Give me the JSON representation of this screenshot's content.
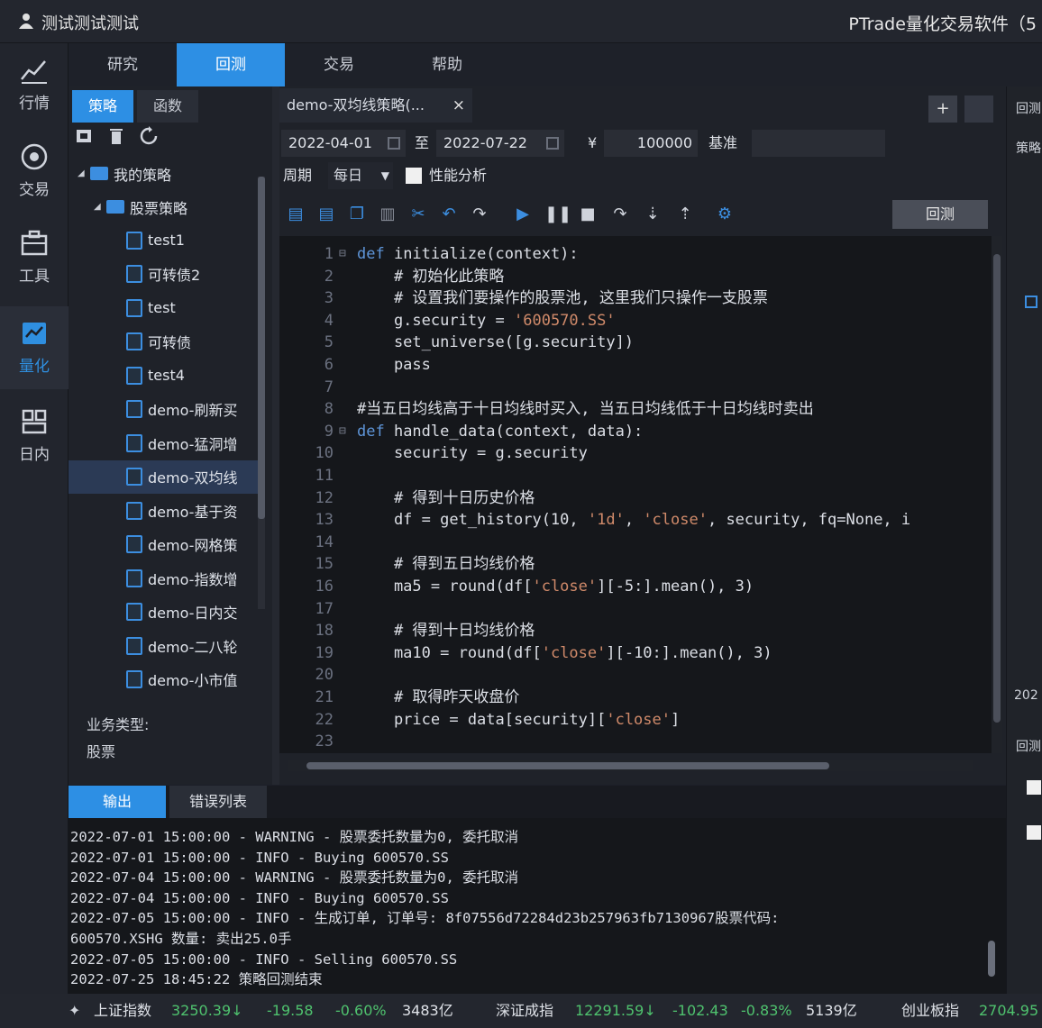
{
  "titlebar": {
    "user": "测试测试测试",
    "app_title": "PTrade量化交易软件（5"
  },
  "nav": [
    {
      "label": "行情",
      "icon": "chart-icon"
    },
    {
      "label": "交易",
      "icon": "trade-icon"
    },
    {
      "label": "工具",
      "icon": "toolbox-icon"
    },
    {
      "label": "量化",
      "icon": "quant-icon"
    },
    {
      "label": "日内",
      "icon": "intraday-icon"
    }
  ],
  "menu": [
    "研究",
    "回测",
    "交易",
    "帮助"
  ],
  "panel": {
    "tabs": [
      "策略",
      "函数"
    ],
    "tree": {
      "root": "我的策略",
      "folder": "股票策略",
      "files": [
        "test1",
        "可转债2",
        "test",
        "可转债",
        "test4",
        "demo-刷新买",
        "demo-猛洞增",
        "demo-双均线",
        "demo-基于资",
        "demo-网格策",
        "demo-指数增",
        "demo-日内交",
        "demo-二八轮",
        "demo-小市值"
      ]
    },
    "biz_label": "业务类型:",
    "biz_value": "股票"
  },
  "editor": {
    "file_tab": "demo-双均线策略(...",
    "close": "×",
    "plus": "+",
    "start_date": "2022-04-01",
    "to": "至",
    "end_date": "2022-07-22",
    "currency": "¥",
    "capital": "100000",
    "benchmark_label": "基准",
    "period_label": "周期",
    "period_value": "每日",
    "perf_label": "性能分析",
    "run_button": "回测"
  },
  "code_lines": [
    [
      "1",
      "def initialize(context):"
    ],
    [
      "2",
      "    # 初始化此策略"
    ],
    [
      "3",
      "    # 设置我们要操作的股票池, 这里我们只操作一支股票"
    ],
    [
      "4",
      "    g.security = '600570.SS'"
    ],
    [
      "5",
      "    set_universe([g.security])"
    ],
    [
      "6",
      "    pass"
    ],
    [
      "7",
      ""
    ],
    [
      "8",
      "#当五日均线高于十日均线时买入, 当五日均线低于十日均线时卖出"
    ],
    [
      "9",
      "def handle_data(context, data):"
    ],
    [
      "10",
      "    security = g.security"
    ],
    [
      "11",
      ""
    ],
    [
      "12",
      "    # 得到十日历史价格"
    ],
    [
      "13",
      "    df = get_history(10, '1d', 'close', security, fq=None, i"
    ],
    [
      "14",
      ""
    ],
    [
      "15",
      "    # 得到五日均线价格"
    ],
    [
      "16",
      "    ma5 = round(df['close'][-5:].mean(), 3)"
    ],
    [
      "17",
      ""
    ],
    [
      "18",
      "    # 得到十日均线价格"
    ],
    [
      "19",
      "    ma10 = round(df['close'][-10:].mean(), 3)"
    ],
    [
      "20",
      ""
    ],
    [
      "21",
      "    # 取得昨天收盘价"
    ],
    [
      "22",
      "    price = data[security]['close']"
    ],
    [
      "23",
      ""
    ]
  ],
  "output": {
    "tabs": [
      "输出",
      "错误列表"
    ],
    "lines": [
      "2022-07-01 15:00:00 - WARNING - 股票委托数量为0, 委托取消",
      "2022-07-01 15:00:00 - INFO - Buying 600570.SS",
      "2022-07-04 15:00:00 - WARNING - 股票委托数量为0, 委托取消",
      "2022-07-04 15:00:00 - INFO - Buying 600570.SS",
      "2022-07-05 15:00:00 - INFO - 生成订单, 订单号: 8f07556d72284d23b257963fb7130967股票代码:",
      "600570.XSHG 数量: 卖出25.0手",
      "2022-07-05 15:00:00 - INFO - Selling 600570.SS",
      "2022-07-25 18:45:22 策略回测结束"
    ]
  },
  "status": [
    {
      "name": "上证指数",
      "value": "3250.39↓",
      "change": "-19.58",
      "pct": "-0.60%",
      "amount": "3483亿"
    },
    {
      "name": "深证成指",
      "value": "12291.59↓",
      "change": "-102.43",
      "pct": "-0.83%",
      "amount": "5139亿"
    },
    {
      "name": "创业板指",
      "value": "2704.95",
      "change": "",
      "pct": "",
      "amount": ""
    }
  ],
  "right_strip": {
    "label1": "回测",
    "label2": "策略",
    "label3": "202",
    "label4": "回测"
  },
  "colors": {
    "accent": "#2d8fe4",
    "down": "#4fc26e",
    "keyword": "#5e95d8",
    "string": "#d08a6a"
  }
}
